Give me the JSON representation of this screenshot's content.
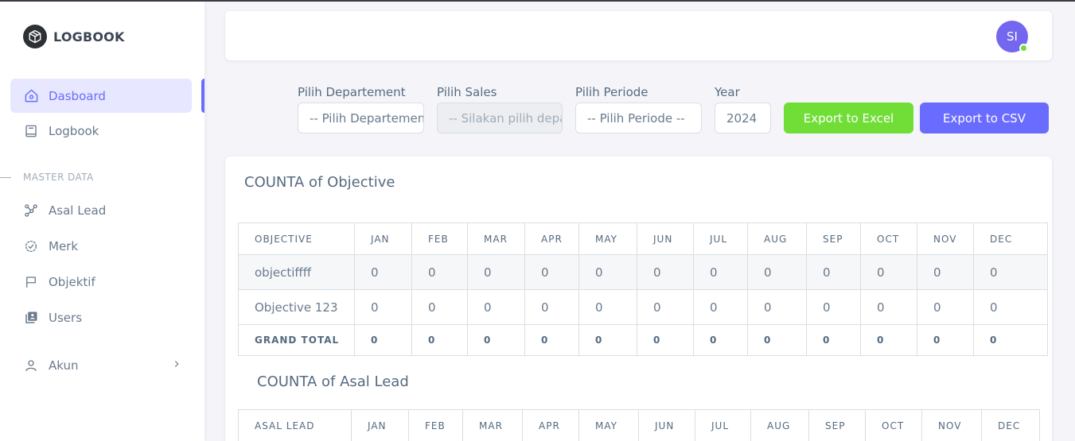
{
  "brand": {
    "name": "LOGBOOK",
    "logo_icon": "cube-icon"
  },
  "sidebar": {
    "items": [
      {
        "label": "Dasboard",
        "icon": "home-icon",
        "active": true
      },
      {
        "label": "Logbook",
        "icon": "book-icon"
      },
      {
        "label": "Asal Lead",
        "icon": "network-icon"
      },
      {
        "label": "Merk",
        "icon": "badge-check-icon"
      },
      {
        "label": "Objektif",
        "icon": "flag-icon"
      },
      {
        "label": "Users",
        "icon": "user-list-icon"
      },
      {
        "label": "Akun",
        "icon": "user-icon"
      }
    ],
    "section_header": "MASTER DATA"
  },
  "navbar": {
    "avatar_initials": "SI",
    "status": "online"
  },
  "filters": {
    "department": {
      "label": "Pilih Departement",
      "value": "-- Pilih Departement --"
    },
    "sales": {
      "label": "Pilih Sales",
      "value": "-- Silakan pilih departement --"
    },
    "periode": {
      "label": "Pilih Periode",
      "value": "-- Pilih Periode --"
    },
    "year": {
      "label": "Year",
      "value": "2024"
    },
    "export_excel": "Export to Excel",
    "export_csv": "Export to CSV"
  },
  "colors": {
    "accent": "#696cff",
    "excel": "#71dd37",
    "online": "#71dd37",
    "avatar": "#7367f0"
  },
  "objective_table": {
    "title": "COUNTA of Objective",
    "headers": [
      "OBJECTIVE",
      "JAN",
      "FEB",
      "MAR",
      "APR",
      "MAY",
      "JUN",
      "JUL",
      "AUG",
      "SEP",
      "OCT",
      "NOV",
      "DEC"
    ],
    "rows": [
      [
        "objectiffff",
        "0",
        "0",
        "0",
        "0",
        "0",
        "0",
        "0",
        "0",
        "0",
        "0",
        "0",
        "0"
      ],
      [
        "Objective 123",
        "0",
        "0",
        "0",
        "0",
        "0",
        "0",
        "0",
        "0",
        "0",
        "0",
        "0",
        "0"
      ],
      [
        "GRAND TOTAL",
        "0",
        "0",
        "0",
        "0",
        "0",
        "0",
        "0",
        "0",
        "0",
        "0",
        "0",
        "0"
      ]
    ]
  },
  "asal_lead_table": {
    "title": "COUNTA of Asal Lead",
    "headers": [
      "ASAL LEAD",
      "JAN",
      "FEB",
      "MAR",
      "APR",
      "MAY",
      "JUN",
      "JUL",
      "AUG",
      "SEP",
      "OCT",
      "NOV",
      "DEC"
    ]
  }
}
